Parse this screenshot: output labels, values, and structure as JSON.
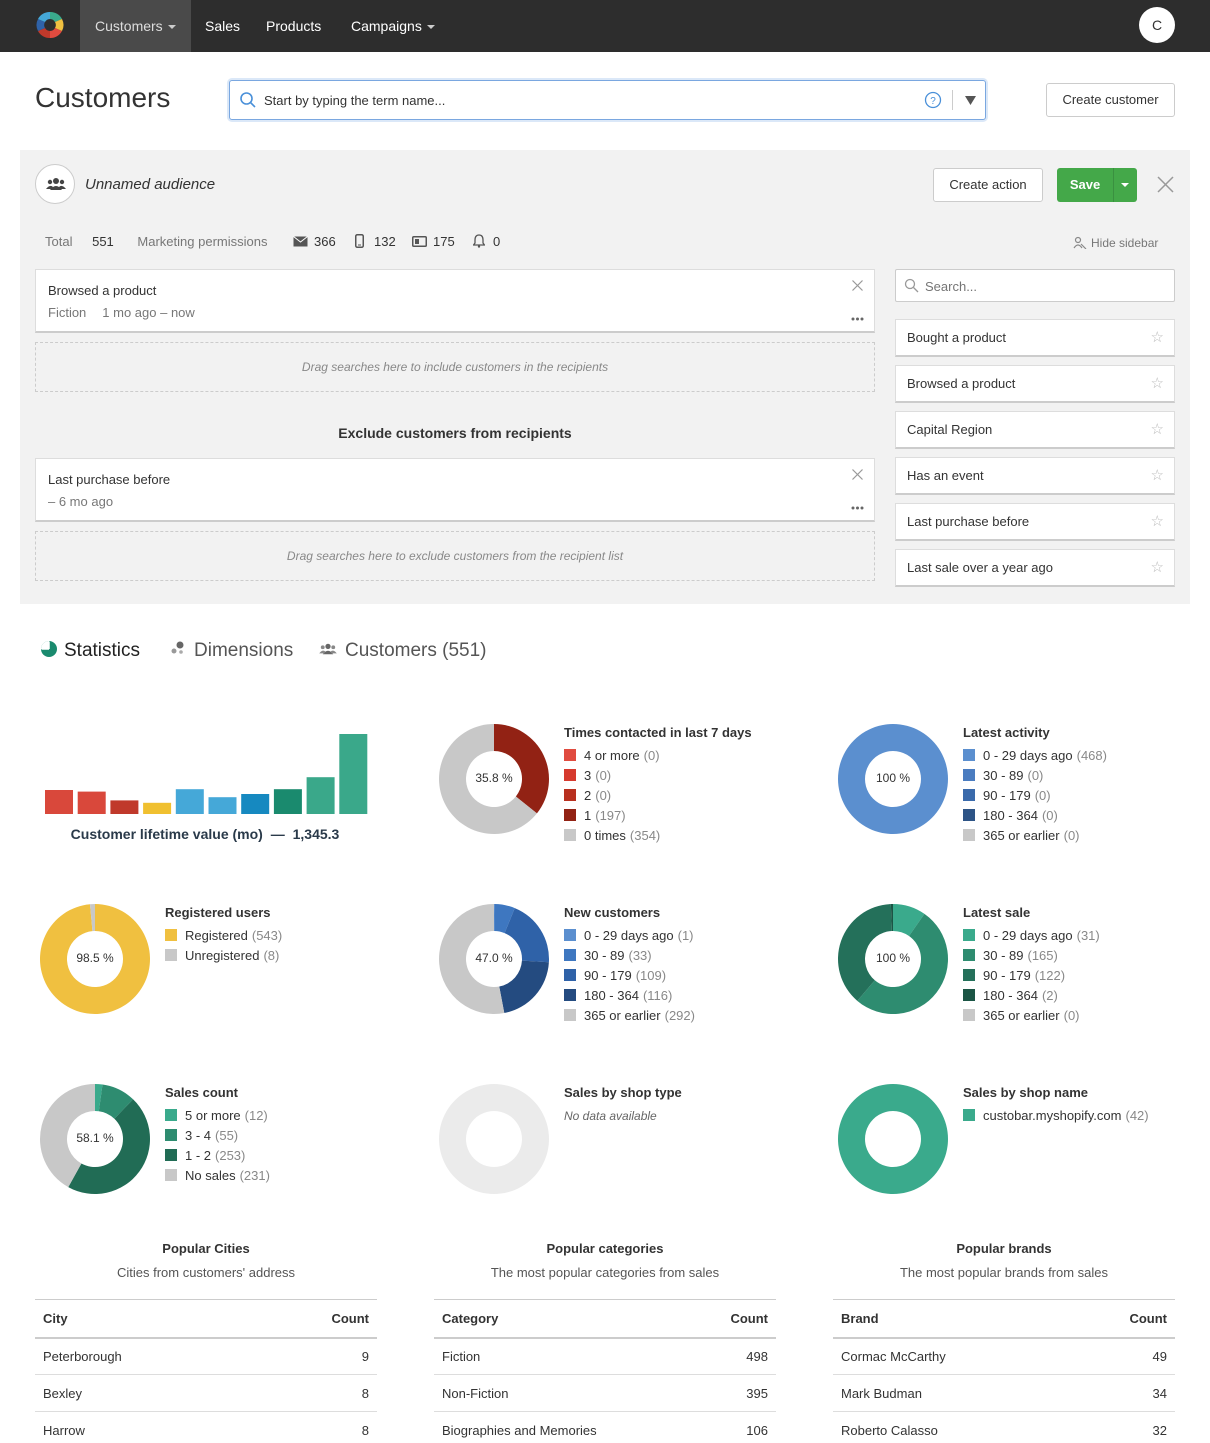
{
  "nav": {
    "items": [
      {
        "label": "Customers",
        "dropdown": true,
        "active": true
      },
      {
        "label": "Sales",
        "dropdown": false
      },
      {
        "label": "Products",
        "dropdown": false
      },
      {
        "label": "Campaigns",
        "dropdown": true
      }
    ],
    "avatar_initial": "C"
  },
  "header": {
    "title": "Customers",
    "search_placeholder": "Start by typing the term name...",
    "create_customer": "Create customer"
  },
  "audience": {
    "name": "Unnamed audience",
    "create_action": "Create action",
    "save": "Save",
    "counts": {
      "total_label": "Total",
      "total": "551",
      "marketing_label": "Marketing permissions",
      "email": "366",
      "sms": "132",
      "mail": "175",
      "push": "0"
    },
    "hide_sidebar": "Hide sidebar",
    "include_filter": {
      "title": "Browsed a product",
      "detail1": "Fiction",
      "detail2": "1 mo ago – now"
    },
    "include_drop": "Drag searches here to include customers in the recipients",
    "exclude_title": "Exclude customers from recipients",
    "exclude_filter": {
      "title": "Last purchase before",
      "detail": "– 6 mo ago"
    },
    "exclude_drop": "Drag searches here to exclude customers from the recipient list",
    "sidebar_search_placeholder": "Search...",
    "saved_searches": [
      "Bought a product",
      "Browsed a product",
      "Capital Region",
      "Has an event",
      "Last purchase before",
      "Last sale over a year ago"
    ]
  },
  "tabs": [
    {
      "label": "Statistics",
      "icon": "pie-icon",
      "active": true
    },
    {
      "label": "Dimensions",
      "icon": "dots-icon",
      "active": false
    },
    {
      "label": "Customers (551)",
      "icon": "people-icon",
      "active": false
    }
  ],
  "stats": {
    "clv": {
      "label": "Customer lifetime value (mo)",
      "sep": "—",
      "value": "1,345.3",
      "bars": [
        0.3,
        0.28,
        0.17,
        0.14,
        0.31,
        0.21,
        0.25,
        0.31,
        0.46,
        1.0
      ],
      "colors": [
        "#d9483b",
        "#d9483b",
        "#c0392b",
        "#f0c030",
        "#45a8d8",
        "#45a8d8",
        "#1689c0",
        "#1a8a6e",
        "#3aa88a",
        "#3aa88a"
      ]
    },
    "times_contacted": {
      "title": "Times contacted in last 7 days",
      "center": "35.8 %",
      "rows": [
        {
          "label": "4 or more",
          "count": "(0)",
          "color": "#e04b3f",
          "value": 0
        },
        {
          "label": "3",
          "count": "(0)",
          "color": "#d63a2e",
          "value": 0
        },
        {
          "label": "2",
          "count": "(0)",
          "color": "#b8301f",
          "value": 0
        },
        {
          "label": "1",
          "count": "(197)",
          "color": "#922214",
          "value": 197
        },
        {
          "label": "0 times",
          "count": "(354)",
          "color": "#c8c8c8",
          "value": 354
        }
      ]
    },
    "latest_activity": {
      "title": "Latest activity",
      "center": "100 %",
      "rows": [
        {
          "label": "0 - 29 days ago",
          "count": "(468)",
          "color": "#5b8fcf",
          "value": 468
        },
        {
          "label": "30 - 89",
          "count": "(0)",
          "color": "#4a7cc0",
          "value": 0
        },
        {
          "label": "90 - 179",
          "count": "(0)",
          "color": "#3a6aab",
          "value": 0
        },
        {
          "label": "180 - 364",
          "count": "(0)",
          "color": "#2d5486",
          "value": 0
        },
        {
          "label": "365 or earlier",
          "count": "(0)",
          "color": "#c8c8c8",
          "value": 0
        }
      ]
    },
    "registered": {
      "title": "Registered users",
      "center": "98.5 %",
      "rows": [
        {
          "label": "Registered",
          "count": "(543)",
          "color": "#f0c040",
          "value": 543
        },
        {
          "label": "Unregistered",
          "count": "(8)",
          "color": "#c8c8c8",
          "value": 8
        }
      ]
    },
    "new_customers": {
      "title": "New customers",
      "center": "47.0 %",
      "rows": [
        {
          "label": "0 - 29 days ago",
          "count": "(1)",
          "color": "#5b8fcf",
          "value": 1
        },
        {
          "label": "30 - 89",
          "count": "(33)",
          "color": "#3e77c0",
          "value": 33
        },
        {
          "label": "90 - 179",
          "count": "(109)",
          "color": "#2f62a8",
          "value": 109
        },
        {
          "label": "180 - 364",
          "count": "(116)",
          "color": "#244b80",
          "value": 116
        },
        {
          "label": "365 or earlier",
          "count": "(292)",
          "color": "#c8c8c8",
          "value": 292
        }
      ]
    },
    "latest_sale": {
      "title": "Latest sale",
      "center": "100 %",
      "rows": [
        {
          "label": "0 - 29 days ago",
          "count": "(31)",
          "color": "#3aaa8c",
          "value": 31
        },
        {
          "label": "30 - 89",
          "count": "(165)",
          "color": "#2e8c70",
          "value": 165
        },
        {
          "label": "90 - 179",
          "count": "(122)",
          "color": "#24705a",
          "value": 122
        },
        {
          "label": "180 - 364",
          "count": "(2)",
          "color": "#1b5545",
          "value": 2
        },
        {
          "label": "365 or earlier",
          "count": "(0)",
          "color": "#c8c8c8",
          "value": 0
        }
      ]
    },
    "sales_count": {
      "title": "Sales count",
      "center": "58.1 %",
      "rows": [
        {
          "label": "5 or more",
          "count": "(12)",
          "color": "#3aaa8c",
          "value": 12
        },
        {
          "label": "3 - 4",
          "count": "(55)",
          "color": "#2e8c70",
          "value": 55
        },
        {
          "label": "1 - 2",
          "count": "(253)",
          "color": "#216c55",
          "value": 253
        },
        {
          "label": "No sales",
          "count": "(231)",
          "color": "#c8c8c8",
          "value": 231
        }
      ]
    },
    "shop_type": {
      "title": "Sales by shop type",
      "empty": "No data available"
    },
    "shop_name": {
      "title": "Sales by shop name",
      "rows": [
        {
          "label": "custobar.myshopify.com",
          "count": "(42)",
          "color": "#3aaa8c",
          "value": 42
        }
      ]
    }
  },
  "tables": {
    "cities": {
      "title": "Popular Cities",
      "subtitle": "Cities from customers' address",
      "columns": [
        "City",
        "Count"
      ],
      "rows": [
        [
          "Peterborough",
          "9"
        ],
        [
          "Bexley",
          "8"
        ],
        [
          "Harrow",
          "8"
        ]
      ]
    },
    "categories": {
      "title": "Popular categories",
      "subtitle": "The most popular categories from sales",
      "columns": [
        "Category",
        "Count"
      ],
      "rows": [
        [
          "Fiction",
          "498"
        ],
        [
          "Non-Fiction",
          "395"
        ],
        [
          "Biographies and Memories",
          "106"
        ]
      ]
    },
    "brands": {
      "title": "Popular brands",
      "subtitle": "The most popular brands from sales",
      "columns": [
        "Brand",
        "Count"
      ],
      "rows": [
        [
          "Cormac McCarthy",
          "49"
        ],
        [
          "Mark Budman",
          "34"
        ],
        [
          "Roberto Calasso",
          "32"
        ]
      ]
    }
  }
}
